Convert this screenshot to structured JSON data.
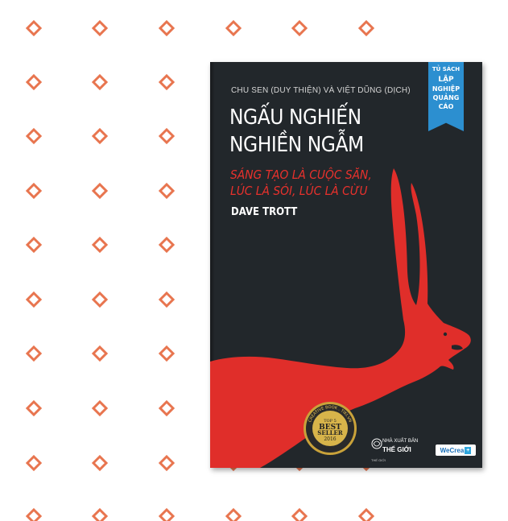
{
  "pattern": {
    "icon": "diamond-outline-icon",
    "color": "#e8754f"
  },
  "book": {
    "cover_color": "#22272b",
    "accent_color": "#e8312c",
    "translators": "CHU SEN (DUY THIỆN) VÀ VIỆT DŨNG (DỊCH)",
    "title_line_1": "NGẤU NGHIẾN",
    "title_line_2": "NGHIỀN NGẪM",
    "subtitle_line_1": "SÁNG TẠO LÀ CUỘC SĂN,",
    "subtitle_line_2": "LÚC LÀ SÓI, LÚC LÀ CỪU",
    "author": "DAVE TROTT",
    "ribbon": {
      "color": "#2c8fd0",
      "line_1": "TỦ SÁCH",
      "line_2": "LẬP",
      "line_3": "NGHIỆP",
      "line_4": "QUẢNG",
      "line_5": "CÁO"
    },
    "seal": {
      "arc_text": "CREATIVE BOOK . TIKI.VN",
      "line_1": "TOP 5",
      "line_2": "BEST",
      "line_3": "SELLER",
      "line_4": "2016"
    },
    "publisher": {
      "label": "NHÀ XUẤT BẢN",
      "name": "THẾ GIỚI",
      "small": "THẾ GIỚI"
    },
    "partner": {
      "name": "WeCrea",
      "plus": "+"
    }
  }
}
